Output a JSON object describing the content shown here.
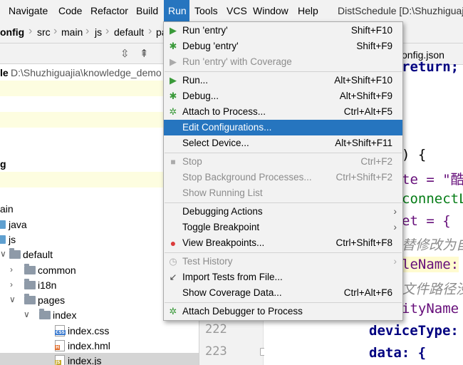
{
  "menubar": {
    "items": [
      "Navigate",
      "Code",
      "Refactor",
      "Build",
      "Run",
      "Tools",
      "VCS",
      "Window",
      "Help"
    ],
    "window_title": "DistSchedule [D:\\Shuzhiguaji"
  },
  "breadcrumb": [
    "onfig",
    "src",
    "main",
    "js",
    "default",
    "pa"
  ],
  "project": {
    "path_label": "le",
    "path": "D:\\Shuzhiguajia\\knowledge_demo",
    "tree": [
      "g",
      "ain",
      "java",
      "js",
      "default",
      "common",
      "i18n",
      "pages",
      "index",
      "index.css",
      "index.hml",
      "index.js"
    ]
  },
  "editor": {
    "tab": "onfig.json",
    "line_numbers": [
      "222",
      "223"
    ],
    "code": {
      "return": "return;",
      "brace1": ") {",
      "te": "te = \"酷",
      "connect": "connectL",
      "et": "et = {",
      "comment1": "替修改为自",
      "lename": "leName:",
      "comment2": "文件路径没",
      "ityname": "ityName",
      "devicetype": "deviceType:",
      "data": "data: {"
    }
  },
  "run_menu": {
    "items": [
      {
        "label": "Run 'entry'",
        "shortcut": "Shift+F10",
        "icon": "run-icon",
        "state": "normal"
      },
      {
        "label": "Debug 'entry'",
        "shortcut": "Shift+F9",
        "icon": "debug-icon",
        "state": "normal"
      },
      {
        "label": "Run 'entry' with Coverage",
        "shortcut": "",
        "icon": "coverage-icon",
        "state": "disabled"
      },
      {
        "label": "Run...",
        "shortcut": "Alt+Shift+F10",
        "icon": "run-icon",
        "state": "normal"
      },
      {
        "label": "Debug...",
        "shortcut": "Alt+Shift+F9",
        "icon": "debug-icon",
        "state": "normal"
      },
      {
        "label": "Attach to Process...",
        "shortcut": "Ctrl+Alt+F5",
        "icon": "attach-icon",
        "state": "normal"
      },
      {
        "label": "Edit Configurations...",
        "shortcut": "",
        "icon": "",
        "state": "selected"
      },
      {
        "label": "Select Device...",
        "shortcut": "Alt+Shift+F11",
        "icon": "",
        "state": "normal"
      },
      {
        "label": "Stop",
        "shortcut": "Ctrl+F2",
        "icon": "stop-icon",
        "state": "disabled"
      },
      {
        "label": "Stop Background Processes...",
        "shortcut": "Ctrl+Shift+F2",
        "icon": "",
        "state": "disabled"
      },
      {
        "label": "Show Running List",
        "shortcut": "",
        "icon": "",
        "state": "disabled"
      },
      {
        "label": "Debugging Actions",
        "shortcut": "",
        "icon": "",
        "state": "submenu"
      },
      {
        "label": "Toggle Breakpoint",
        "shortcut": "",
        "icon": "",
        "state": "submenu"
      },
      {
        "label": "View Breakpoints...",
        "shortcut": "Ctrl+Shift+F8",
        "icon": "breakpoints-icon",
        "state": "normal"
      },
      {
        "label": "Test History",
        "shortcut": "",
        "icon": "history-icon",
        "state": "disabled-submenu"
      },
      {
        "label": "Import Tests from File...",
        "shortcut": "",
        "icon": "import-icon",
        "state": "normal"
      },
      {
        "label": "Show Coverage Data...",
        "shortcut": "Ctrl+Alt+F6",
        "icon": "",
        "state": "normal"
      },
      {
        "label": "Attach Debugger to Process",
        "shortcut": "",
        "icon": "attach-icon",
        "state": "normal"
      }
    ]
  },
  "colors": {
    "menu_bg": "#f2f2f2",
    "selection": "#2675bf",
    "run_green": "#3a9a3a",
    "breakpoint_red": "#db3b3b",
    "code_keyword": "#000080",
    "code_property": "#660e7a",
    "code_string": "#067d17"
  }
}
